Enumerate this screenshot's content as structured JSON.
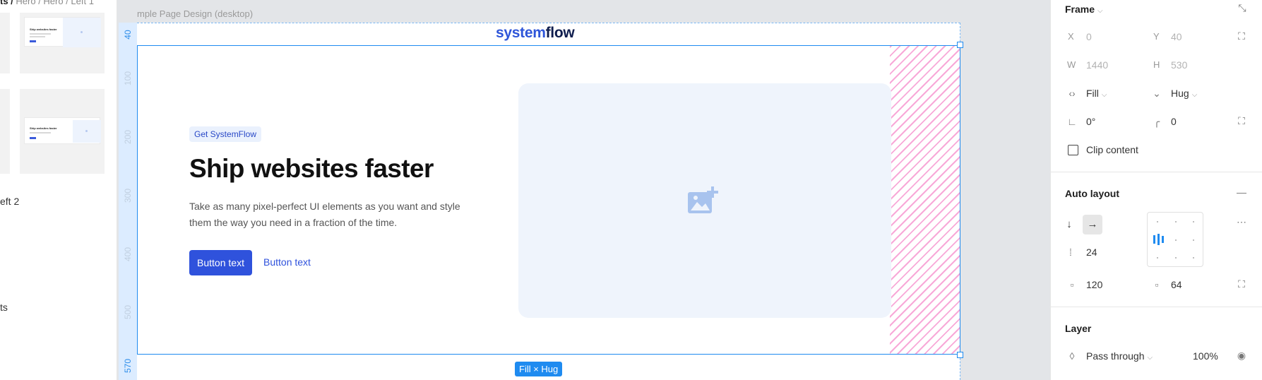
{
  "left_panel": {
    "breadcrumb_current": "ts /",
    "breadcrumb_path": " Hero / Hero / Left 1",
    "item_label_1": "eft 2",
    "item_label_2": "ts"
  },
  "canvas": {
    "frame_name": "mple Page Design (desktop)",
    "ruler_ticks": [
      "40",
      "100",
      "200",
      "300",
      "400",
      "500",
      "570"
    ],
    "logo_part1": "system",
    "logo_part2": "flow",
    "size_tag": "Fill × Hug"
  },
  "hero": {
    "badge": "Get SystemFlow",
    "headline": "Ship websites faster",
    "subtext": "Take as many pixel-perfect UI elements as you want and style them the way you need in a fraction of the time.",
    "primary_button": "Button text",
    "secondary_button": "Button text"
  },
  "properties": {
    "frame_title": "Frame",
    "x_label": "X",
    "x_value": "0",
    "y_label": "Y",
    "y_value": "40",
    "w_label": "W",
    "w_value": "1440",
    "h_label": "H",
    "h_value": "530",
    "width_mode": "Fill",
    "height_mode": "Hug",
    "rotation": "0°",
    "corner_radius": "0",
    "clip_content": "Clip content",
    "auto_layout_title": "Auto layout",
    "gap": "24",
    "horizontal_padding": "120",
    "vertical_padding": "64",
    "layer_title": "Layer",
    "blend_mode": "Pass through",
    "opacity": "100%"
  },
  "colors": {
    "accent": "#2f52dc",
    "selection": "#1f8bf0",
    "logo_dark": "#0e1c4d",
    "padding_hatch": "#f8a9d8"
  }
}
